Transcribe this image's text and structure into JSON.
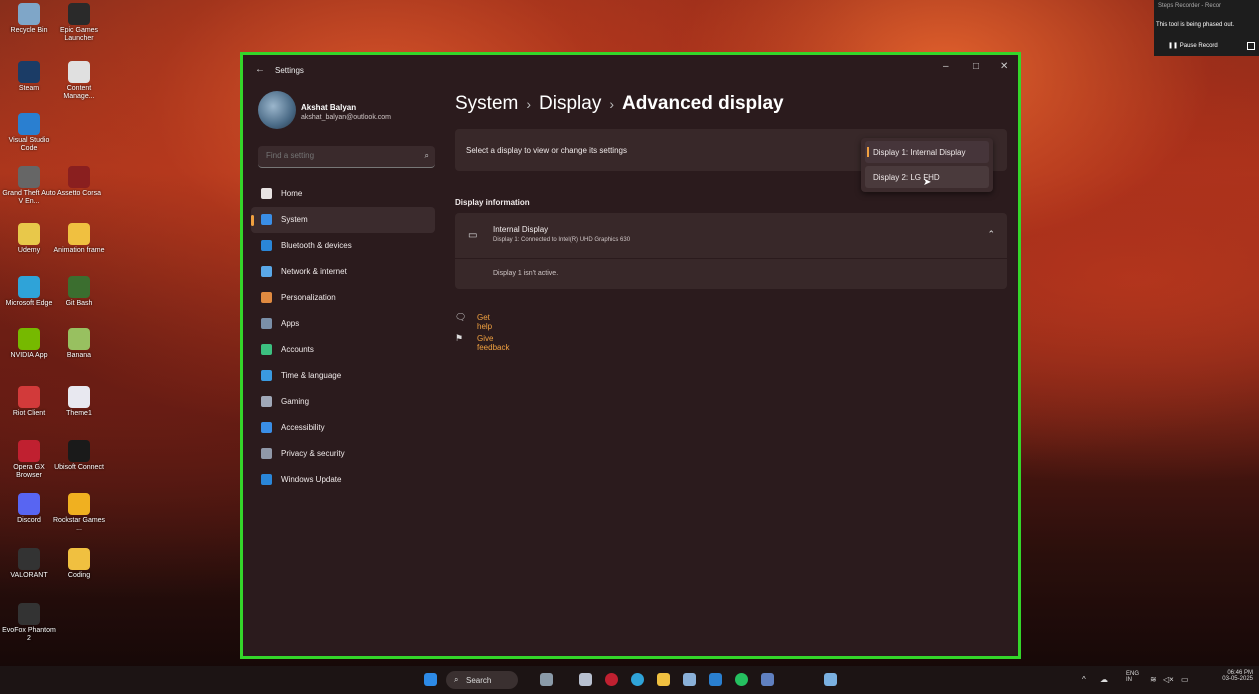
{
  "desktop": {
    "icons": [
      {
        "label": "Recycle Bin",
        "color": "#7fa6c8"
      },
      {
        "label": "Epic Games Launcher",
        "color": "#2a2a2a"
      },
      {
        "label": "Steam",
        "color": "#1b3c66"
      },
      {
        "label": "Content Manage...",
        "color": "#e0e0e0"
      },
      {
        "label": "Visual Studio Code",
        "color": "#2a7fd0"
      },
      {
        "label": "Grand Theft Auto V En...",
        "color": "#666666"
      },
      {
        "label": "Assetto Corsa",
        "color": "#8a1f1f"
      },
      {
        "label": "Udemy",
        "color": "#e8c84a"
      },
      {
        "label": "Animation frame",
        "color": "#f0c040"
      },
      {
        "label": "Microsoft Edge",
        "color": "#2fa3d8"
      },
      {
        "label": "Git Bash",
        "color": "#3b6e2f"
      },
      {
        "label": "NVIDIA App",
        "color": "#76b900"
      },
      {
        "label": "Banana",
        "color": "#98c060"
      },
      {
        "label": "Riot Client",
        "color": "#d23a3a"
      },
      {
        "label": "Theme1",
        "color": "#e8e8f0"
      },
      {
        "label": "Opera GX Browser",
        "color": "#c02030"
      },
      {
        "label": "Ubisoft Connect",
        "color": "#1a1a1a"
      },
      {
        "label": "Discord",
        "color": "#5865f2"
      },
      {
        "label": "Rockstar Games ...",
        "color": "#f0b020"
      },
      {
        "label": "VALORANT",
        "color": "#333333"
      },
      {
        "label": "Coding",
        "color": "#f0c040"
      },
      {
        "label": "EvoFox Phantom 2",
        "color": "#333333"
      }
    ]
  },
  "window": {
    "title": "Settings",
    "back_glyph": "←",
    "minimize": "–",
    "maximize": "□",
    "close": "✕"
  },
  "profile": {
    "name": "Akshat Balyan",
    "email": "akshat_balyan@outlook.com"
  },
  "search": {
    "placeholder": "Find a setting",
    "icon_glyph": "⌕"
  },
  "nav": [
    {
      "label": "Home",
      "icon": "home-icon",
      "color": "#e8e2e2"
    },
    {
      "label": "System",
      "icon": "system-icon",
      "color": "#3a8ee6",
      "active": true
    },
    {
      "label": "Bluetooth & devices",
      "icon": "bluetooth-icon",
      "color": "#2a86d8"
    },
    {
      "label": "Network & internet",
      "icon": "network-icon",
      "color": "#5aa8e8"
    },
    {
      "label": "Personalization",
      "icon": "personalization-icon",
      "color": "#e08a40"
    },
    {
      "label": "Apps",
      "icon": "apps-icon",
      "color": "#7a8fa8"
    },
    {
      "label": "Accounts",
      "icon": "accounts-icon",
      "color": "#3cc080"
    },
    {
      "label": "Time & language",
      "icon": "time-language-icon",
      "color": "#3a9ae0"
    },
    {
      "label": "Gaming",
      "icon": "gaming-icon",
      "color": "#a0a8b8"
    },
    {
      "label": "Accessibility",
      "icon": "accessibility-icon",
      "color": "#3a8ee6"
    },
    {
      "label": "Privacy & security",
      "icon": "privacy-icon",
      "color": "#9098a8"
    },
    {
      "label": "Windows Update",
      "icon": "windows-update-icon",
      "color": "#2a86d8"
    }
  ],
  "breadcrumb": {
    "part1": "System",
    "sep": "›",
    "part2": "Display",
    "part3": "Advanced display"
  },
  "display_selector": {
    "label": "Select a display to view or change its settings",
    "options": [
      "Display 1: Internal Display",
      "Display 2: LG FHD"
    ],
    "selected": "Display 1: Internal Display"
  },
  "display_info": {
    "section_title": "Display information",
    "name": "Internal Display",
    "subtitle": "Display 1: Connected to Intel(R) UHD Graphics 630",
    "status": "Display 1 isn't active.",
    "chevron": "⌃"
  },
  "links": {
    "help": "Get help",
    "feedback": "Give feedback"
  },
  "steps_recorder": {
    "title": "Steps Recorder - Recor",
    "notice": "This tool is being phased out.",
    "pause": "Pause Record"
  },
  "taskbar": {
    "search_label": "Search",
    "lang_top": "ENG",
    "lang_bottom": "IN",
    "time": "06:46 PM",
    "date": "03-05-2025"
  },
  "colors": {
    "accent": "#f0a040",
    "highlight_border": "#34d62a"
  }
}
